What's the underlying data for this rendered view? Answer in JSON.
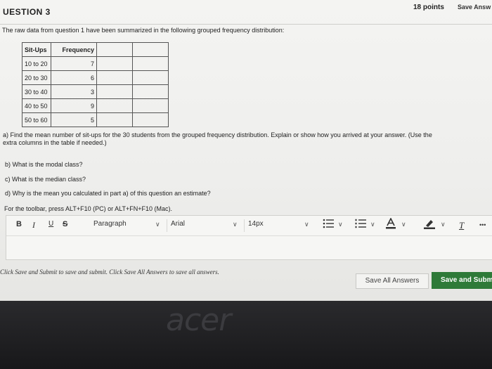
{
  "question": {
    "title": "UESTION 3",
    "points": "18 points",
    "save_answer": "Save Answ",
    "intro": "The raw data from question 1 have been summarized in the following grouped frequency distribution:",
    "table": {
      "headers": [
        "Sit-Ups",
        "Frequency"
      ],
      "rows": [
        {
          "class": "10 to 20",
          "freq": "7"
        },
        {
          "class": "20 to 30",
          "freq": "6"
        },
        {
          "class": "30 to 40",
          "freq": "3"
        },
        {
          "class": "40 to 50",
          "freq": "9"
        },
        {
          "class": "50 to 60",
          "freq": "5"
        }
      ]
    },
    "part_a_line1": "a) Find the mean number of sit-ups for the 30 students from the grouped frequency distribution. Explain or show how you arrived at your answer. (Use the",
    "part_a_line2": "extra columns in the table if needed.)",
    "part_b": "b) What is the modal class?",
    "part_c": "c) What is the median class?",
    "part_d": "d) Why is the mean you calculated in part a) of this question an estimate?",
    "toolbar_hint": "For the toolbar, press ALT+F10 (PC) or ALT+FN+F10 (Mac)."
  },
  "editor": {
    "bold": "B",
    "italic": "I",
    "underline": "U",
    "strike": "S",
    "paragraph": "Paragraph",
    "font": "Arial",
    "size": "14px",
    "clear_format": "T",
    "more": "•••"
  },
  "footer": {
    "submit_note": "Click Save and Submit to save and submit. Click Save All Answers to save all answers.",
    "save_all": "Save All Answers",
    "save_submit": "Save and Submi"
  },
  "bezel": {
    "brand": "acer"
  },
  "colors": {
    "submit_button": "#2e7a38"
  }
}
